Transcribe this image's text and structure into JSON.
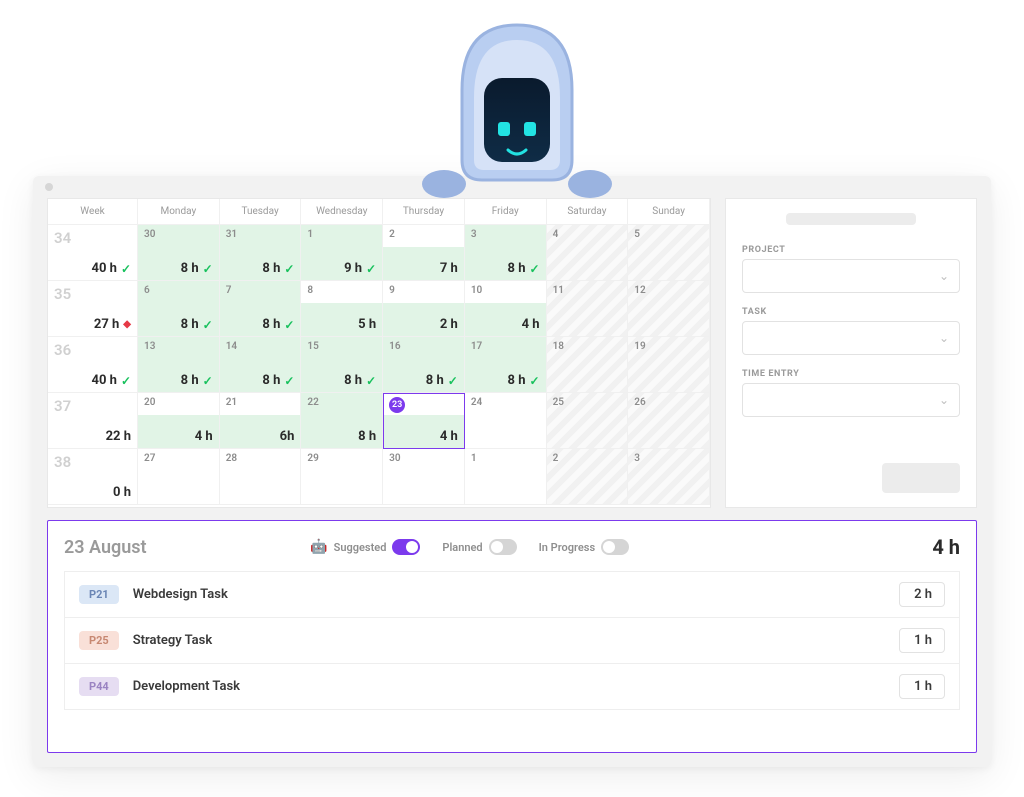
{
  "calendar": {
    "headers": [
      "Week",
      "Monday",
      "Tuesday",
      "Wednesday",
      "Thursday",
      "Friday",
      "Saturday",
      "Sunday"
    ],
    "weeks": [
      {
        "num": "34",
        "total": "40 h",
        "total_status": "check",
        "days": [
          {
            "date": "30",
            "hours": "8 h",
            "status": "check",
            "fill": "green"
          },
          {
            "date": "31",
            "hours": "8 h",
            "status": "check",
            "fill": "green"
          },
          {
            "date": "1",
            "hours": "9 h",
            "status": "check",
            "fill": "green"
          },
          {
            "date": "2",
            "hours": "7 h",
            "status": "",
            "fill": "gap"
          },
          {
            "date": "3",
            "hours": "8 h",
            "status": "check",
            "fill": "green"
          },
          {
            "date": "4",
            "hours": "",
            "status": "",
            "fill": "weekend"
          },
          {
            "date": "5",
            "hours": "",
            "status": "",
            "fill": "weekend"
          }
        ]
      },
      {
        "num": "35",
        "total": "27 h",
        "total_status": "diamond",
        "days": [
          {
            "date": "6",
            "hours": "8 h",
            "status": "check",
            "fill": "green"
          },
          {
            "date": "7",
            "hours": "8 h",
            "status": "check",
            "fill": "green"
          },
          {
            "date": "8",
            "hours": "5 h",
            "status": "",
            "fill": "gap"
          },
          {
            "date": "9",
            "hours": "2 h",
            "status": "",
            "fill": "gap"
          },
          {
            "date": "10",
            "hours": "4 h",
            "status": "",
            "fill": "gap"
          },
          {
            "date": "11",
            "hours": "",
            "status": "",
            "fill": "weekend"
          },
          {
            "date": "12",
            "hours": "",
            "status": "",
            "fill": "weekend"
          }
        ]
      },
      {
        "num": "36",
        "total": "40 h",
        "total_status": "check",
        "days": [
          {
            "date": "13",
            "hours": "8 h",
            "status": "check",
            "fill": "green"
          },
          {
            "date": "14",
            "hours": "8 h",
            "status": "check",
            "fill": "green"
          },
          {
            "date": "15",
            "hours": "8 h",
            "status": "check",
            "fill": "green"
          },
          {
            "date": "16",
            "hours": "8 h",
            "status": "check",
            "fill": "green"
          },
          {
            "date": "17",
            "hours": "8 h",
            "status": "check",
            "fill": "green"
          },
          {
            "date": "18",
            "hours": "",
            "status": "",
            "fill": "weekend"
          },
          {
            "date": "19",
            "hours": "",
            "status": "",
            "fill": "weekend"
          }
        ]
      },
      {
        "num": "37",
        "total": "22 h",
        "total_status": "",
        "days": [
          {
            "date": "20",
            "hours": "4 h",
            "status": "",
            "fill": "gap"
          },
          {
            "date": "21",
            "hours": "6h",
            "status": "",
            "fill": "gap"
          },
          {
            "date": "22",
            "hours": "8 h",
            "status": "",
            "fill": "green"
          },
          {
            "date": "23",
            "hours": "4 h",
            "status": "",
            "fill": "gap",
            "selected": true,
            "badge": true
          },
          {
            "date": "24",
            "hours": "",
            "status": "",
            "fill": ""
          },
          {
            "date": "25",
            "hours": "",
            "status": "",
            "fill": "weekend"
          },
          {
            "date": "26",
            "hours": "",
            "status": "",
            "fill": "weekend"
          }
        ]
      },
      {
        "num": "38",
        "total": "0 h",
        "total_status": "",
        "days": [
          {
            "date": "27",
            "hours": "",
            "status": "",
            "fill": ""
          },
          {
            "date": "28",
            "hours": "",
            "status": "",
            "fill": ""
          },
          {
            "date": "29",
            "hours": "",
            "status": "",
            "fill": ""
          },
          {
            "date": "30",
            "hours": "",
            "status": "",
            "fill": ""
          },
          {
            "date": "1",
            "hours": "",
            "status": "",
            "fill": ""
          },
          {
            "date": "2",
            "hours": "",
            "status": "",
            "fill": "weekend"
          },
          {
            "date": "3",
            "hours": "",
            "status": "",
            "fill": "weekend"
          }
        ]
      }
    ]
  },
  "sidebar": {
    "project_label": "PROJECT",
    "task_label": "TASK",
    "time_entry_label": "TIME ENTRY"
  },
  "detail": {
    "date_label": "23 August",
    "total": "4 h",
    "filters": {
      "suggested": "Suggested",
      "planned": "Planned",
      "in_progress": "In Progress"
    },
    "tasks": [
      {
        "tag": "P21",
        "tag_class": "blue",
        "name": "Webdesign Task",
        "hours": "2 h"
      },
      {
        "tag": "P25",
        "tag_class": "peach",
        "name": "Strategy Task",
        "hours": "1 h"
      },
      {
        "tag": "P44",
        "tag_class": "lilac",
        "name": "Development Task",
        "hours": "1 h"
      }
    ]
  }
}
